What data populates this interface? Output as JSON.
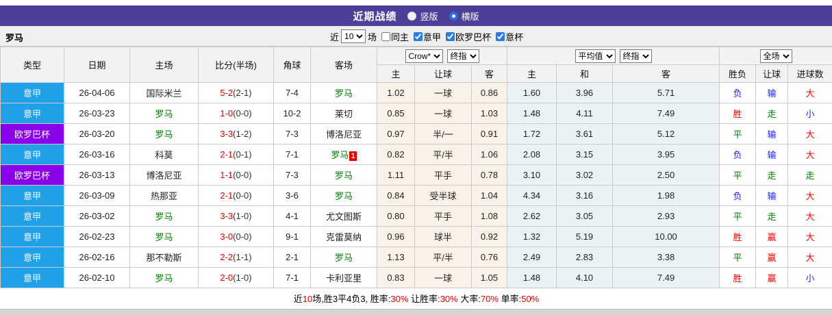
{
  "colors": {
    "titlebar_bg": "#4C3F97",
    "league_serie_a": "#1FA0E8",
    "league_europa": "#8A00EA",
    "roma_green": "#008000",
    "score_red": "#E60000",
    "accent_red": "#E60000",
    "result_red": "#FF0000",
    "result_green": "#008000",
    "result_blue": "#2222EE",
    "asian_bg": "#FAF2E9",
    "euro_bg": "#E9F3F6"
  },
  "header": {
    "title": "近期战绩",
    "vertical_label": "竖版",
    "horizontal_label": "横版"
  },
  "filter": {
    "team": "罗马",
    "recent_label": "近",
    "recent_value": "10",
    "matches_label": "场",
    "checkboxes": [
      {
        "label": "同主",
        "checked": false
      },
      {
        "label": "意甲",
        "checked": true
      },
      {
        "label": "欧罗巴杯",
        "checked": true
      },
      {
        "label": "意杯",
        "checked": true
      }
    ]
  },
  "table": {
    "static_headers": [
      "类型",
      "日期",
      "主场",
      "比分(半场)",
      "角球",
      "客场"
    ],
    "dropdowns": {
      "asian_source": "Crow*",
      "asian_mode": "终指",
      "euro_source": "平均值",
      "euro_mode": "终指",
      "result_scope": "全场"
    },
    "sub_headers": [
      "主",
      "让球",
      "客",
      "主",
      "和",
      "客",
      "胜负",
      "让球",
      "进球数"
    ],
    "rows": [
      {
        "league": "意甲",
        "league_color": "blue",
        "date": "26-04-06",
        "home": {
          "text": "国际米兰",
          "is_roma": false
        },
        "score": {
          "full": "5-2",
          "half": "(2-1)"
        },
        "corner": "7-4",
        "away": {
          "text": "罗马",
          "is_roma": true,
          "red_card": null
        },
        "asian": {
          "home": "1.02",
          "line": "一球",
          "away": "0.86"
        },
        "euro": {
          "home": "1.60",
          "draw": "3.96",
          "away": "5.71"
        },
        "result": [
          [
            "负",
            "blue"
          ],
          [
            "输",
            "blue"
          ],
          [
            "大",
            "red"
          ]
        ]
      },
      {
        "league": "意甲",
        "league_color": "blue",
        "date": "26-03-23",
        "home": {
          "text": "罗马",
          "is_roma": true
        },
        "score": {
          "full": "1-0",
          "half": "(0-0)"
        },
        "corner": "10-2",
        "away": {
          "text": "莱切",
          "is_roma": false,
          "red_card": null
        },
        "asian": {
          "home": "0.85",
          "line": "一球",
          "away": "1.03"
        },
        "euro": {
          "home": "1.48",
          "draw": "4.11",
          "away": "7.49"
        },
        "result": [
          [
            "胜",
            "red"
          ],
          [
            "走",
            "green"
          ],
          [
            "小",
            "blue"
          ]
        ]
      },
      {
        "league": "欧罗巴杯",
        "league_color": "purple",
        "date": "26-03-20",
        "home": {
          "text": "罗马",
          "is_roma": true
        },
        "score": {
          "full": "3-3",
          "half": "(1-2)"
        },
        "corner": "7-3",
        "away": {
          "text": "博洛尼亚",
          "is_roma": false,
          "red_card": null
        },
        "asian": {
          "home": "0.97",
          "line": "半/一",
          "away": "0.91"
        },
        "euro": {
          "home": "1.72",
          "draw": "3.61",
          "away": "5.12"
        },
        "result": [
          [
            "平",
            "green"
          ],
          [
            "输",
            "blue"
          ],
          [
            "大",
            "red"
          ]
        ]
      },
      {
        "league": "意甲",
        "league_color": "blue",
        "date": "26-03-16",
        "home": {
          "text": "科莫",
          "is_roma": false
        },
        "score": {
          "full": "2-1",
          "half": "(0-1)"
        },
        "corner": "7-1",
        "away": {
          "text": "罗马",
          "is_roma": true,
          "red_card": "1"
        },
        "asian": {
          "home": "0.82",
          "line": "平/半",
          "away": "1.06"
        },
        "euro": {
          "home": "2.08",
          "draw": "3.15",
          "away": "3.95"
        },
        "result": [
          [
            "负",
            "blue"
          ],
          [
            "输",
            "blue"
          ],
          [
            "大",
            "red"
          ]
        ]
      },
      {
        "league": "欧罗巴杯",
        "league_color": "purple",
        "date": "26-03-13",
        "home": {
          "text": "博洛尼亚",
          "is_roma": false
        },
        "score": {
          "full": "1-1",
          "half": "(0-0)"
        },
        "corner": "7-3",
        "away": {
          "text": "罗马",
          "is_roma": true,
          "red_card": null
        },
        "asian": {
          "home": "1.11",
          "line": "平手",
          "away": "0.78"
        },
        "euro": {
          "home": "3.10",
          "draw": "3.02",
          "away": "2.50"
        },
        "result": [
          [
            "平",
            "green"
          ],
          [
            "走",
            "green"
          ],
          [
            "走",
            "green"
          ]
        ]
      },
      {
        "league": "意甲",
        "league_color": "blue",
        "date": "26-03-09",
        "home": {
          "text": "热那亚",
          "is_roma": false
        },
        "score": {
          "full": "2-1",
          "half": "(0-0)"
        },
        "corner": "3-6",
        "away": {
          "text": "罗马",
          "is_roma": true,
          "red_card": null
        },
        "asian": {
          "home": "0.84",
          "line": "受半球",
          "away": "1.04"
        },
        "euro": {
          "home": "4.34",
          "draw": "3.16",
          "away": "1.98"
        },
        "result": [
          [
            "负",
            "blue"
          ],
          [
            "输",
            "blue"
          ],
          [
            "大",
            "red"
          ]
        ]
      },
      {
        "league": "意甲",
        "league_color": "blue",
        "date": "26-03-02",
        "home": {
          "text": "罗马",
          "is_roma": true
        },
        "score": {
          "full": "3-3",
          "half": "(1-0)"
        },
        "corner": "4-1",
        "away": {
          "text": "尤文图斯",
          "is_roma": false,
          "red_card": null
        },
        "asian": {
          "home": "0.80",
          "line": "平手",
          "away": "1.08"
        },
        "euro": {
          "home": "2.62",
          "draw": "3.05",
          "away": "2.93"
        },
        "result": [
          [
            "平",
            "green"
          ],
          [
            "走",
            "green"
          ],
          [
            "大",
            "red"
          ]
        ]
      },
      {
        "league": "意甲",
        "league_color": "blue",
        "date": "26-02-23",
        "home": {
          "text": "罗马",
          "is_roma": true
        },
        "score": {
          "full": "3-0",
          "half": "(0-0)"
        },
        "corner": "9-1",
        "away": {
          "text": "克雷莫纳",
          "is_roma": false,
          "red_card": null
        },
        "asian": {
          "home": "0.96",
          "line": "球半",
          "away": "0.92"
        },
        "euro": {
          "home": "1.32",
          "draw": "5.19",
          "away": "10.00"
        },
        "result": [
          [
            "胜",
            "red"
          ],
          [
            "赢",
            "red"
          ],
          [
            "大",
            "red"
          ]
        ]
      },
      {
        "league": "意甲",
        "league_color": "blue",
        "date": "26-02-16",
        "home": {
          "text": "那不勒斯",
          "is_roma": false
        },
        "score": {
          "full": "2-2",
          "half": "(1-1)"
        },
        "corner": "2-1",
        "away": {
          "text": "罗马",
          "is_roma": true,
          "red_card": null
        },
        "asian": {
          "home": "1.13",
          "line": "平/半",
          "away": "0.76"
        },
        "euro": {
          "home": "2.49",
          "draw": "2.83",
          "away": "3.38"
        },
        "result": [
          [
            "平",
            "green"
          ],
          [
            "赢",
            "red"
          ],
          [
            "大",
            "red"
          ]
        ]
      },
      {
        "league": "意甲",
        "league_color": "blue",
        "date": "26-02-10",
        "home": {
          "text": "罗马",
          "is_roma": true
        },
        "score": {
          "full": "2-0",
          "half": "(1-0)"
        },
        "corner": "7-1",
        "away": {
          "text": "卡利亚里",
          "is_roma": false,
          "red_card": null
        },
        "asian": {
          "home": "0.83",
          "line": "一球",
          "away": "1.05"
        },
        "euro": {
          "home": "1.48",
          "draw": "4.10",
          "away": "7.49"
        },
        "result": [
          [
            "胜",
            "red"
          ],
          [
            "赢",
            "red"
          ],
          [
            "小",
            "blue"
          ]
        ]
      }
    ]
  },
  "summary": {
    "segments": [
      [
        "近",
        "black"
      ],
      [
        "10",
        "red"
      ],
      [
        "场,胜3平4负3, 胜率:",
        "black"
      ],
      [
        "30%",
        "red"
      ],
      [
        " 让胜率:",
        "black"
      ],
      [
        "30%",
        "red"
      ],
      [
        " 大率:",
        "black"
      ],
      [
        "70%",
        "red"
      ],
      [
        " 单率:",
        "black"
      ],
      [
        "50%",
        "red"
      ]
    ]
  }
}
